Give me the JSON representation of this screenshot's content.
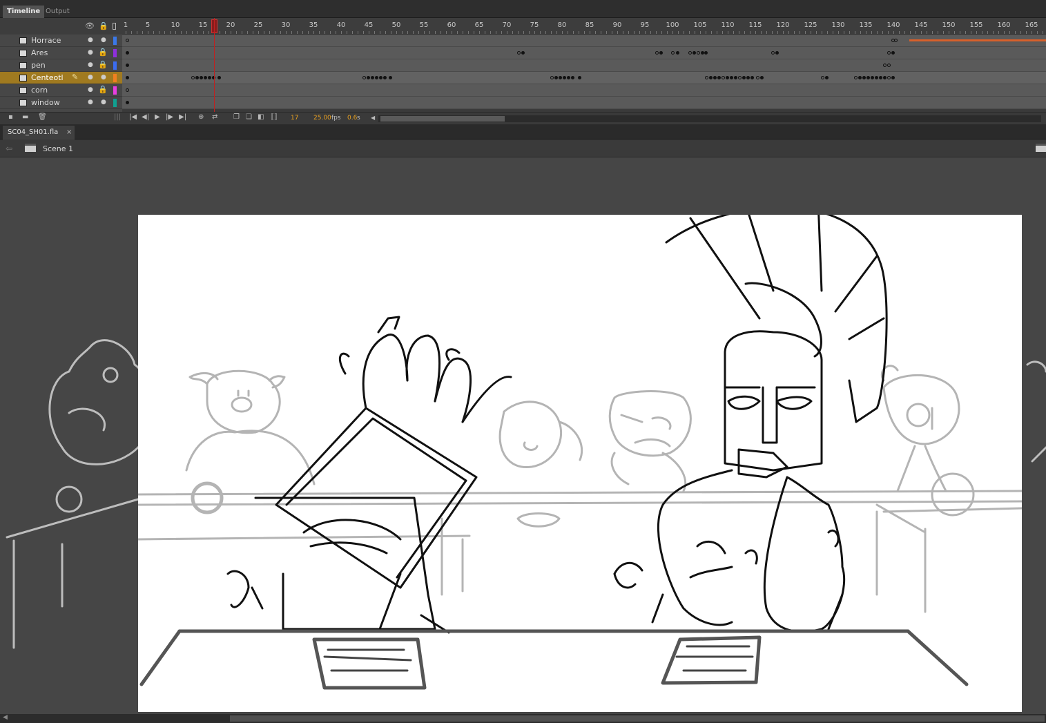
{
  "panel_tabs": [
    {
      "label": "Timeline",
      "active": true
    },
    {
      "label": "Output",
      "active": false
    }
  ],
  "ruler_labels": [
    "1",
    "5",
    "10",
    "15",
    "20",
    "25",
    "30",
    "35",
    "40",
    "45",
    "50",
    "55",
    "60",
    "65",
    "70",
    "75",
    "80",
    "85",
    "90",
    "95",
    "100",
    "105",
    "110",
    "115",
    "120",
    "125",
    "130",
    "135",
    "140",
    "145",
    "150",
    "155",
    "160",
    "165"
  ],
  "layers": [
    {
      "name": "Horrace",
      "color": "#3b78e7",
      "locked": false,
      "active": false
    },
    {
      "name": "Ares",
      "color": "#8f2fdc",
      "locked": true,
      "active": false
    },
    {
      "name": "pen",
      "color": "#3b6cf0",
      "locked": true,
      "active": false
    },
    {
      "name": "Centeotl",
      "color": "#f08020",
      "locked": false,
      "active": true
    },
    {
      "name": "corn",
      "color": "#e83ee0",
      "locked": true,
      "active": false
    },
    {
      "name": "window",
      "color": "#10a090",
      "locked": false,
      "active": false
    }
  ],
  "playback": {
    "current_frame": "17",
    "fps": "25.00",
    "fps_unit": "fps",
    "time": "0.6",
    "time_unit": "s"
  },
  "document": {
    "tab_label": "SC04_SH01.fla",
    "close_glyph": "×",
    "scene_label": "Scene 1"
  },
  "icons": [
    "eye-icon",
    "lock-icon",
    "outline-icon",
    "pencil-icon",
    "new-layer-icon",
    "new-folder-icon",
    "delete-icon",
    "first-frame-icon",
    "step-back-icon",
    "play-icon",
    "step-forward-icon",
    "last-frame-icon",
    "loop-icon",
    "onion-skin-icon",
    "clapperboard-icon"
  ]
}
